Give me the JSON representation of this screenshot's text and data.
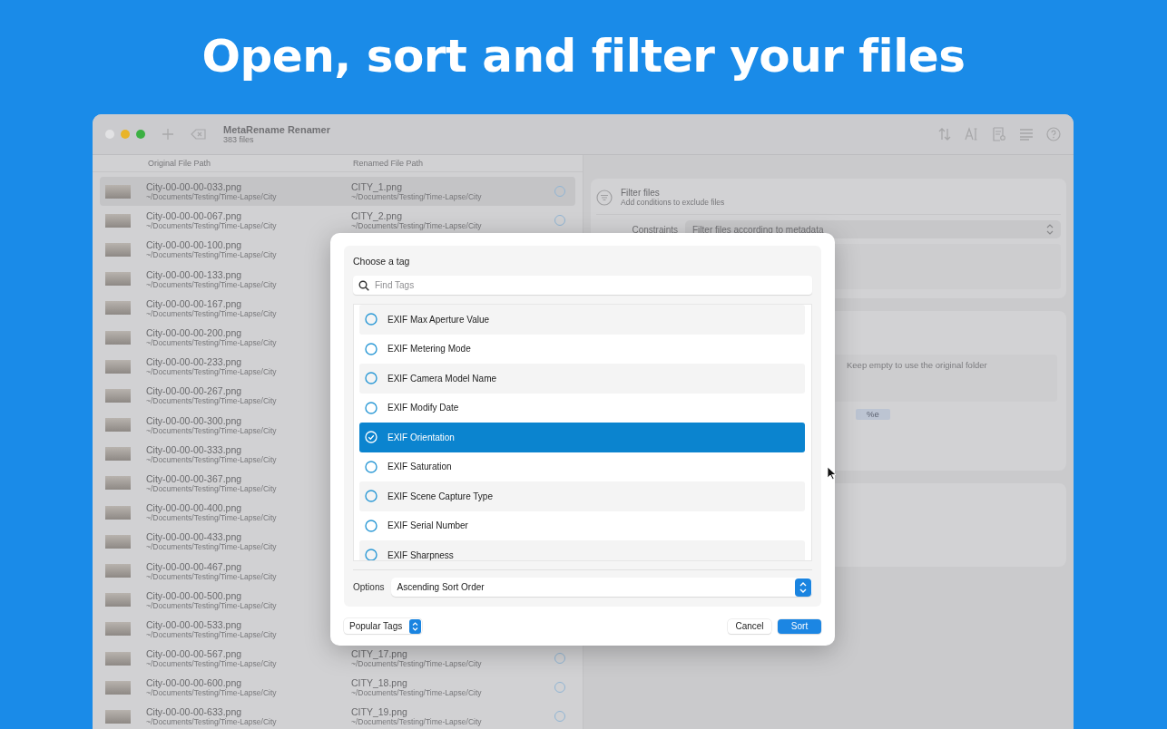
{
  "headline": "Open, sort and filter your files",
  "window": {
    "title": "MetaRename Renamer",
    "subtitle": "383 files"
  },
  "columns": [
    "Original File Path",
    "Renamed File Path"
  ],
  "files": [
    {
      "name": "City-00-00-00-033.png",
      "path": "~/Documents/Testing/Time-Lapse/City",
      "renamed": "CITY_1.png",
      "renamed_path": "~/Documents/Testing/Time-Lapse/City",
      "selected": true
    },
    {
      "name": "City-00-00-00-067.png",
      "path": "~/Documents/Testing/Time-Lapse/City",
      "renamed": "CITY_2.png",
      "renamed_path": "~/Documents/Testing/Time-Lapse/City",
      "selected": false
    },
    {
      "name": "City-00-00-00-100.png",
      "path": "~/Documents/Testing/Time-Lapse/City",
      "selected": false
    },
    {
      "name": "City-00-00-00-133.png",
      "path": "~/Documents/Testing/Time-Lapse/City",
      "selected": false
    },
    {
      "name": "City-00-00-00-167.png",
      "path": "~/Documents/Testing/Time-Lapse/City",
      "selected": false
    },
    {
      "name": "City-00-00-00-200.png",
      "path": "~/Documents/Testing/Time-Lapse/City",
      "selected": false
    },
    {
      "name": "City-00-00-00-233.png",
      "path": "~/Documents/Testing/Time-Lapse/City",
      "selected": false
    },
    {
      "name": "City-00-00-00-267.png",
      "path": "~/Documents/Testing/Time-Lapse/City",
      "selected": false
    },
    {
      "name": "City-00-00-00-300.png",
      "path": "~/Documents/Testing/Time-Lapse/City",
      "selected": false
    },
    {
      "name": "City-00-00-00-333.png",
      "path": "~/Documents/Testing/Time-Lapse/City",
      "selected": false
    },
    {
      "name": "City-00-00-00-367.png",
      "path": "~/Documents/Testing/Time-Lapse/City",
      "selected": false
    },
    {
      "name": "City-00-00-00-400.png",
      "path": "~/Documents/Testing/Time-Lapse/City",
      "selected": false
    },
    {
      "name": "City-00-00-00-433.png",
      "path": "~/Documents/Testing/Time-Lapse/City",
      "selected": false
    },
    {
      "name": "City-00-00-00-467.png",
      "path": "~/Documents/Testing/Time-Lapse/City",
      "selected": false
    },
    {
      "name": "City-00-00-00-500.png",
      "path": "~/Documents/Testing/Time-Lapse/City",
      "selected": false
    },
    {
      "name": "City-00-00-00-533.png",
      "path": "~/Documents/Testing/Time-Lapse/City",
      "selected": false
    },
    {
      "name": "City-00-00-00-567.png",
      "path": "~/Documents/Testing/Time-Lapse/City",
      "renamed": "CITY_17.png",
      "renamed_path": "~/Documents/Testing/Time-Lapse/City",
      "selected": false
    },
    {
      "name": "City-00-00-00-600.png",
      "path": "~/Documents/Testing/Time-Lapse/City",
      "renamed": "CITY_18.png",
      "renamed_path": "~/Documents/Testing/Time-Lapse/City",
      "selected": false
    },
    {
      "name": "City-00-00-00-633.png",
      "path": "~/Documents/Testing/Time-Lapse/City",
      "renamed": "CITY_19.png",
      "renamed_path": "~/Documents/Testing/Time-Lapse/City",
      "selected": false
    }
  ],
  "filter_panel": {
    "title": "Filter files",
    "subtitle": "Add conditions to exclude files",
    "constraints_label": "Constraints",
    "constraints_value": "Filter files according to metadata"
  },
  "output_panel": {
    "folder_placeholder": "Keep empty to use the original folder",
    "tokens": [
      "%e"
    ]
  },
  "dialog": {
    "heading": "Choose a tag",
    "search_placeholder": "Find Tags",
    "tags": [
      {
        "label": "EXIF Max Aperture Value",
        "selected": false
      },
      {
        "label": "EXIF Metering Mode",
        "selected": false
      },
      {
        "label": "EXIF Camera Model Name",
        "selected": false
      },
      {
        "label": "EXIF Modify Date",
        "selected": false
      },
      {
        "label": "EXIF Orientation",
        "selected": true
      },
      {
        "label": "EXIF Saturation",
        "selected": false
      },
      {
        "label": "EXIF Scene Capture Type",
        "selected": false
      },
      {
        "label": "EXIF Serial Number",
        "selected": false
      },
      {
        "label": "EXIF Sharpness",
        "selected": false
      }
    ],
    "options_label": "Options",
    "options_value": "Ascending Sort Order",
    "source": "Popular Tags",
    "cancel": "Cancel",
    "confirm": "Sort"
  }
}
